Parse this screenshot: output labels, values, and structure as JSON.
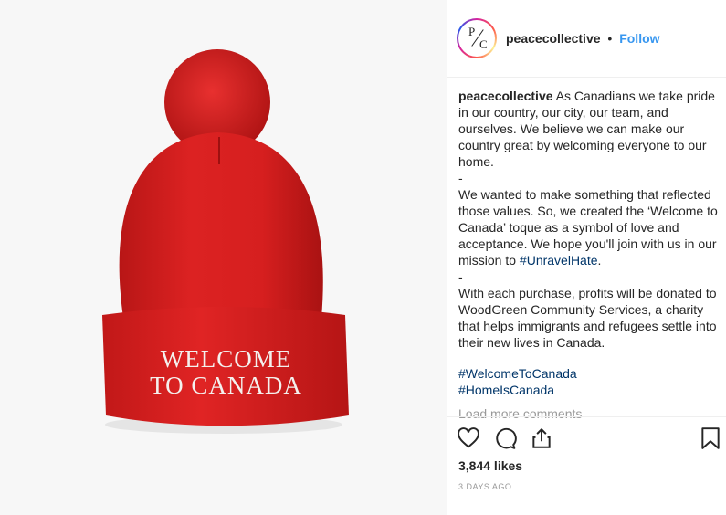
{
  "image": {
    "toque_text_line1": "WELCOME",
    "toque_text_line2": "TO CANADA",
    "colors": {
      "toque": "#d81c1c",
      "background": "#f7f7f7"
    }
  },
  "header": {
    "avatar_letters": {
      "top": "P",
      "bottom": "C"
    },
    "username": "peacecollective",
    "separator": "•",
    "follow_label": "Follow"
  },
  "caption": {
    "username": "peacecollective",
    "para1": "As Canadians we take pride in our country, our city, our team, and ourselves. We believe we can make our country great by welcoming everyone to our home.",
    "sep1": "-",
    "para2_pre": "We wanted to make something that reflected those values. So, we created the ‘Welcome to Canada’ toque as a symbol of love and acceptance. We hope you'll join with us in our mission to ",
    "para2_tag": "#UnravelHate",
    "para2_post": ".",
    "sep2": "-",
    "para3": "With each purchase, profits will be donated to WoodGreen Community Services, a charity that helps immigrants and refugees settle into their new lives in Canada."
  },
  "hashtags": [
    "#WelcomeToCanada",
    "#HomeIsCanada"
  ],
  "load_more_label": "Load more comments",
  "actions": {
    "icons": [
      "heart-icon",
      "comment-icon",
      "share-icon",
      "bookmark-icon"
    ]
  },
  "likes_label": "3,844 likes",
  "time_label": "3 DAYS AGO",
  "colors": {
    "link": "#3897f0",
    "hashtag": "#003569",
    "muted": "#999999"
  }
}
